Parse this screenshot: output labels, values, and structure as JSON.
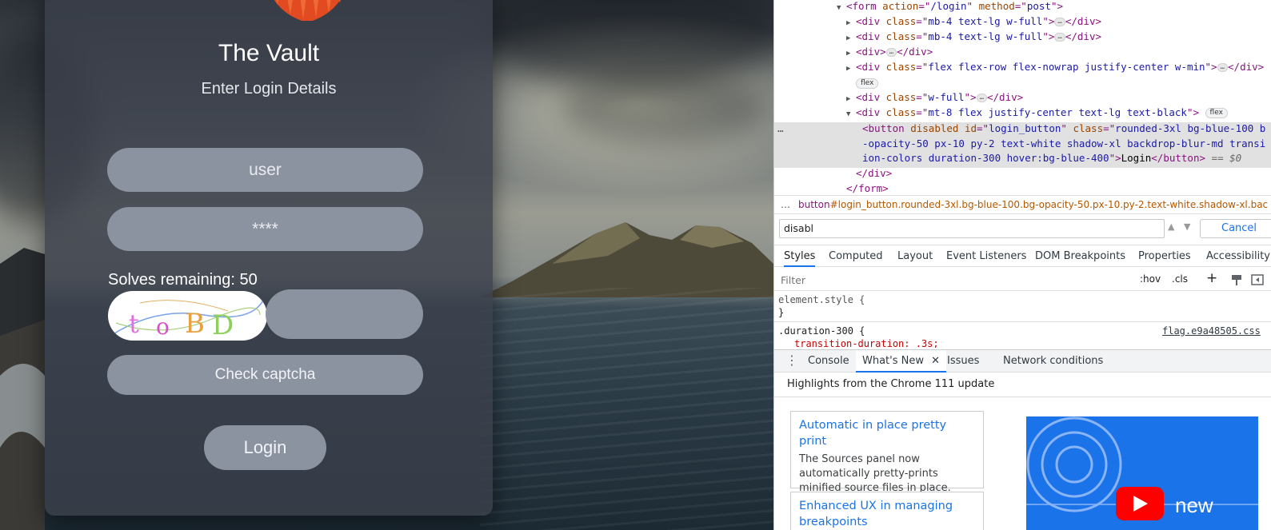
{
  "vault": {
    "title": "The Vault",
    "subtitle": "Enter Login Details",
    "username_placeholder": "user",
    "password_placeholder": "****",
    "solves_remaining": "Solves remaining: 50",
    "captcha_text": "t o B D",
    "check_captcha_label": "Check captcha",
    "login_label": "Login"
  },
  "devtools": {
    "dom": {
      "form_open": "form",
      "form_action_name": "action",
      "form_action_val": "/login",
      "form_method_name": "method",
      "form_method_val": "post",
      "div": "div",
      "class": "class",
      "row1_class": "mb-4 text-lg w-full",
      "row2_class": "mb-4 text-lg w-full",
      "row4_class": "flex flex-row flex-nowrap justify-center w-min",
      "row5_class": "w-full",
      "row6_class": "mt-8 flex justify-center text-lg text-black",
      "flex_badge": "flex",
      "button": "button",
      "disabled": "disabled",
      "id": "id",
      "button_id": "login_button",
      "button_class_l1": "rounded-3xl bg-blue-100 b",
      "button_class_l2": "-opacity-50 px-10 py-2 text-white shadow-xl backdrop-blur-md transi",
      "button_class_l3": "ion-colors duration-300 hover:bg-blue-400",
      "button_text": "Login",
      "eq": " == $0",
      "ellipsis": "…",
      "dots": "…"
    },
    "breadcrumb_tag": "button",
    "breadcrumb_rest": "#login_button.rounded-3xl.bg-blue-100.bg-opacity-50.px-10.py-2.text-white.shadow-xl.bac",
    "search_value": "disabl",
    "search_cancel": "Cancel",
    "tabs": [
      "Styles",
      "Computed",
      "Layout",
      "Event Listeners",
      "DOM Breakpoints",
      "Properties",
      "Accessibility"
    ],
    "filter_placeholder": "Filter",
    "hov": ":hov",
    "cls": ".cls",
    "styles": {
      "element_style": "element.style {",
      "close_brace": "}",
      "rule_selector": ".duration-300 {",
      "rule_source": "flag.e9a48505.css",
      "rule_prop": "transition-duration: .3s;"
    },
    "drawer_tabs": [
      "Console",
      "What's New",
      "Issues",
      "Network conditions"
    ],
    "whats_new_heading": "Highlights from the Chrome 111 update",
    "cards": [
      {
        "title": "Automatic in place pretty print",
        "body": "The Sources panel now automatically pretty-prints minified source files in place."
      },
      {
        "title": "Enhanced UX in managing breakpoints",
        "body": ""
      }
    ],
    "video_label": "new"
  },
  "colors": {
    "card_bg": "#3a404a",
    "pill_bg": "#8b92a0",
    "devtools_accent": "#1a73e8",
    "dom_tag": "#881280",
    "dom_attr": "#994500",
    "dom_value": "#1a1aa6"
  }
}
